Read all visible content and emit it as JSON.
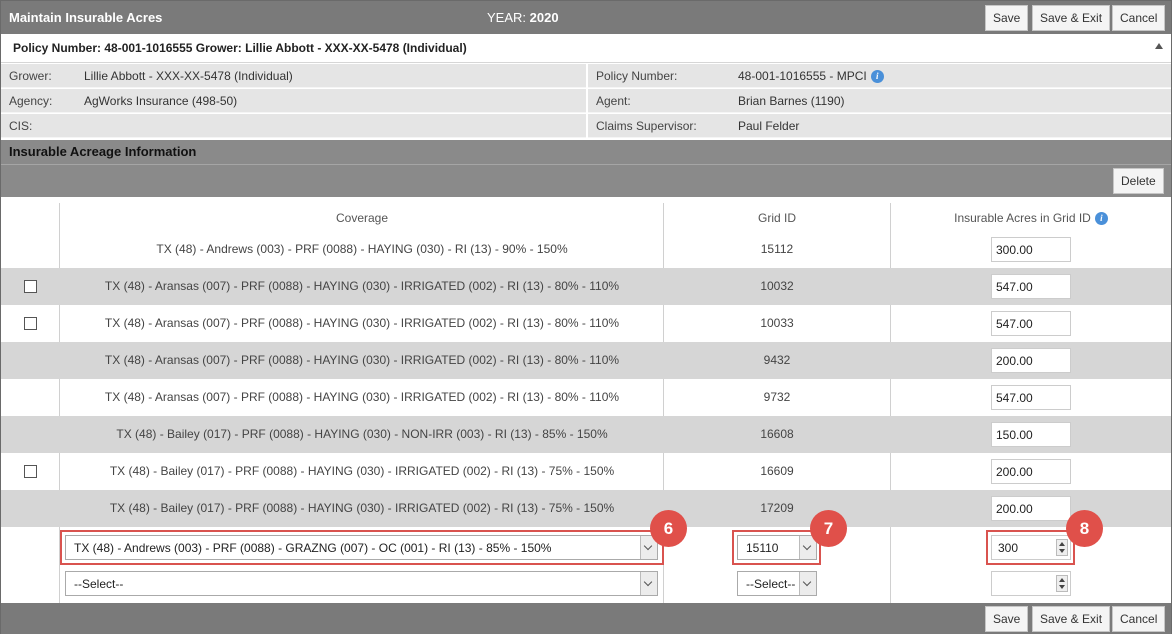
{
  "window": {
    "title": "Maintain Insurable Acres",
    "year_label": "YEAR:",
    "year_value": "2020",
    "save": "Save",
    "save_exit": "Save & Exit",
    "cancel": "Cancel"
  },
  "policy_header": "Policy Number: 48-001-1016555 Grower: Lillie Abbott - XXX-XX-5478 (Individual)",
  "info": {
    "grower_label": "Grower:",
    "grower_value": "Lillie Abbott - XXX-XX-5478 (Individual)",
    "agency_label": "Agency:",
    "agency_value": "AgWorks Insurance (498-50)",
    "cis_label": "CIS:",
    "policy_label": "Policy Number:",
    "policy_value": "48-001-1016555 - MPCI",
    "agent_label": "Agent:",
    "agent_value": "Brian Barnes (1190)",
    "claims_label": "Claims Supervisor:",
    "claims_value": "Paul Felder"
  },
  "section_title": "Insurable Acreage Information",
  "delete_label": "Delete",
  "table": {
    "headers": {
      "coverage": "Coverage",
      "grid": "Grid ID",
      "acres": "Insurable Acres in Grid ID"
    },
    "rows": [
      {
        "coverage": "TX (48) - Andrews (003) - PRF (0088) - HAYING (030) - RI (13) - 90% - 150%",
        "grid": "15112",
        "acres": "300.00"
      },
      {
        "coverage": "TX (48) - Aransas (007) - PRF (0088) - HAYING (030) - IRRIGATED (002) - RI (13) - 80% - 110%",
        "grid": "10032",
        "acres": "547.00"
      },
      {
        "coverage": "TX (48) - Aransas (007) - PRF (0088) - HAYING (030) - IRRIGATED (002) - RI (13) - 80% - 110%",
        "grid": "10033",
        "acres": "547.00"
      },
      {
        "coverage": "TX (48) - Aransas (007) - PRF (0088) - HAYING (030) - IRRIGATED (002) - RI (13) - 80% - 110%",
        "grid": "9432",
        "acres": "200.00"
      },
      {
        "coverage": "TX (48) - Aransas (007) - PRF (0088) - HAYING (030) - IRRIGATED (002) - RI (13) - 80% - 110%",
        "grid": "9732",
        "acres": "547.00"
      },
      {
        "coverage": "TX (48) - Bailey (017) - PRF (0088) - HAYING (030) - NON-IRR (003) - RI (13) - 85% - 150%",
        "grid": "16608",
        "acres": "150.00"
      },
      {
        "coverage": "TX (48) - Bailey (017) - PRF (0088) - HAYING (030) - IRRIGATED (002) - RI (13) - 75% - 150%",
        "grid": "16609",
        "acres": "200.00"
      },
      {
        "coverage": "TX (48) - Bailey (017) - PRF (0088) - HAYING (030) - IRRIGATED (002) - RI (13) - 75% - 150%",
        "grid": "17209",
        "acres": "200.00"
      }
    ],
    "new_row": {
      "coverage": "TX (48) - Andrews (003) - PRF (0088) - GRAZNG (007) - OC (001) - RI (13) - 85% - 150%",
      "grid": "15110",
      "acres": "300"
    },
    "blank_row": {
      "coverage": "--Select--",
      "grid": "--Select--",
      "acres": ""
    }
  },
  "badges": {
    "coverage": "6",
    "grid": "7",
    "acres": "8"
  },
  "colors": {
    "titlebar": "#7a7a7a",
    "alt_row": "#d6d6d6",
    "highlight": "#d9534f",
    "info_icon": "#4a90d9"
  }
}
